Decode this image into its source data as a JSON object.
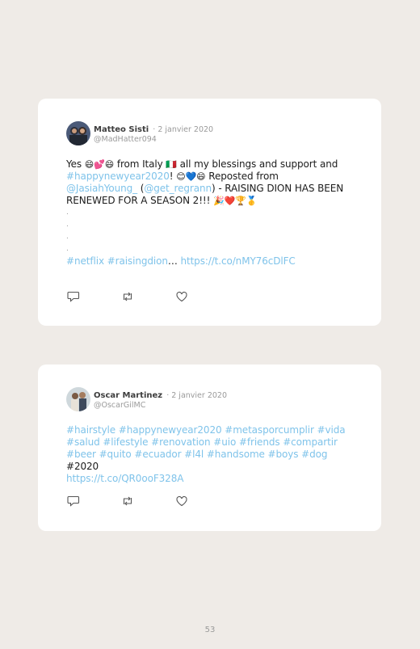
{
  "tweets": [
    {
      "author": "Matteo Sisti",
      "date": "· 2 janvier 2020",
      "handle": "@MadHatter094",
      "text": {
        "yes": "Yes ",
        "emoji1": "😄💕😄",
        "from_italy": " from Italy ",
        "flag": "🇮🇹",
        "blessings": " all my blessings and support and",
        "tag_newyear": "#happynewyear2020",
        "excl": "! ",
        "emoji2": "😊💙😄",
        "reposted": " Reposted from",
        "mention1": "@JasiahYoung_",
        "paren_open": " (",
        "mention2": "@get_regrann",
        "raising": ") - RAISING DION HAS BEEN RENEWED FOR A SEASON 2!!! ",
        "emoji3": "🎉❤️🏆🥇",
        "dot": ".",
        "tags_end": "#netflix #raisingdion",
        "ellipsis": "… ",
        "url": "https://t.co/nMY76cDlFC"
      }
    },
    {
      "author": "Oscar Martinez",
      "date": "· 2 janvier 2020",
      "handle": "@OscarGilMC",
      "text": {
        "tags": "#hairstyle #happynewyear2020 #metasporcumplir #vida #salud #lifestyle #renovation #uio #friends #compartir #beer #quito #ecuador #l4l #handsome #boys #dog",
        "plain": " #2020",
        "url": "https://t.co/QR0ooF328A"
      }
    }
  ],
  "icons": [
    "reply-icon",
    "retweet-icon",
    "like-icon"
  ],
  "page_number": "53",
  "colors": {
    "link": "#7fc3ea",
    "background": "#efebe7",
    "card": "#ffffff"
  }
}
